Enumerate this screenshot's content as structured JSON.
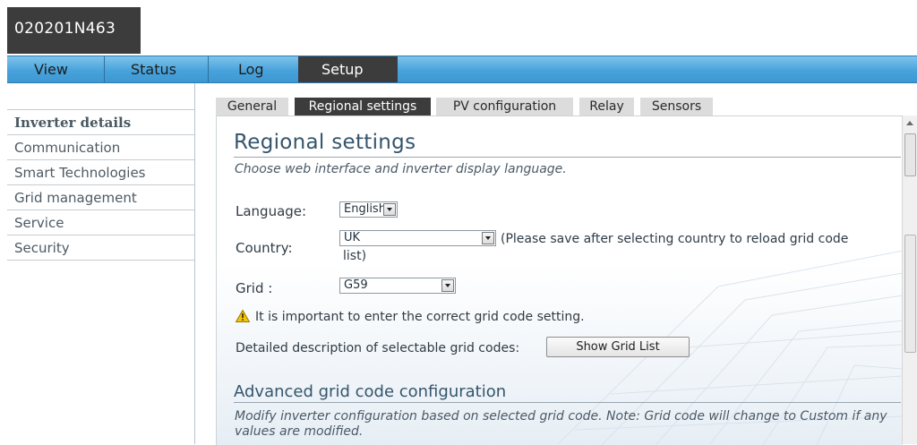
{
  "device": {
    "serial": "020201N463"
  },
  "nav": {
    "items": [
      {
        "label": "View"
      },
      {
        "label": "Status"
      },
      {
        "label": "Log"
      },
      {
        "label": "Setup"
      }
    ],
    "active": "Setup"
  },
  "sidebar": {
    "items": [
      {
        "label": "Inverter details"
      },
      {
        "label": "Communication"
      },
      {
        "label": "Smart Technologies"
      },
      {
        "label": "Grid management"
      },
      {
        "label": "Service"
      },
      {
        "label": "Security"
      }
    ]
  },
  "subtabs": [
    {
      "label": "General"
    },
    {
      "label": "Regional settings"
    },
    {
      "label": "PV configuration"
    },
    {
      "label": "Relay"
    },
    {
      "label": "Sensors"
    }
  ],
  "page": {
    "title": "Regional settings",
    "subtitle": "Choose web interface and inverter display language.",
    "language": {
      "label": "Language:",
      "value": "English"
    },
    "country": {
      "label": "Country:",
      "value": "UK",
      "note_a": "(Please save after selecting country to reload grid code",
      "note_b": "list)"
    },
    "grid": {
      "label": "Grid :",
      "value": "G59"
    },
    "warning": "It is important to enter the correct grid code setting.",
    "detail_label": "Detailed description of selectable grid codes:",
    "show_grid_button": "Show Grid List",
    "advanced_title": "Advanced grid code configuration",
    "advanced_desc": "Modify inverter configuration based on selected grid code. Note: Grid code will change to Custom if any values are modified."
  },
  "colors": {
    "nav_blue": "#48a3dc",
    "dark_tab": "#3c3c3c",
    "heading": "#35556b"
  }
}
